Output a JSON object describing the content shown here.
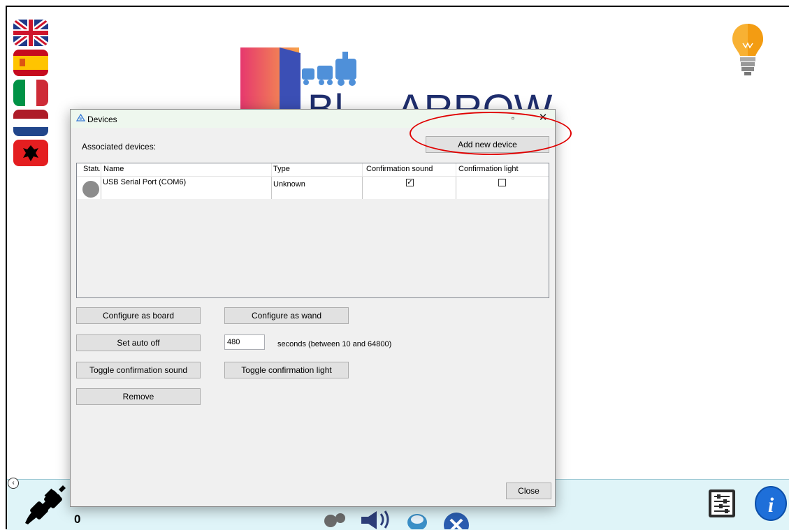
{
  "app": {
    "logo_text": "BlueARROW",
    "counter": "0"
  },
  "flags": [
    {
      "icon": "uk-flag-icon"
    },
    {
      "icon": "spain-flag-icon"
    },
    {
      "icon": "italy-flag-icon"
    },
    {
      "icon": "netherlands-flag-icon"
    },
    {
      "icon": "albania-flag-icon"
    }
  ],
  "dialog": {
    "title": "Devices",
    "maximize_glyph": "▫",
    "close_glyph": "✕",
    "associated_label": "Associated devices:",
    "add_button": "Add new device",
    "columns": [
      "Status",
      "Name",
      "Type",
      "Confirmation sound",
      "Confirmation light"
    ],
    "rows": [
      {
        "name": "USB Serial Port (COM6)",
        "type": "Unknown",
        "confirmation_sound": true,
        "confirmation_light": false
      }
    ],
    "buttons": {
      "configure_board": "Configure as board",
      "configure_wand": "Configure as wand",
      "set_auto_off": "Set auto off",
      "toggle_sound": "Toggle confirmation sound",
      "toggle_light": "Toggle confirmation light",
      "remove": "Remove",
      "close": "Close"
    },
    "auto_off_value": "480",
    "seconds_label": "seconds (between 10 and 64800)"
  },
  "colors": {
    "annotation": "#e00000",
    "bottom_bar": "#dff4f8",
    "info_blue": "#1e6fd9"
  }
}
